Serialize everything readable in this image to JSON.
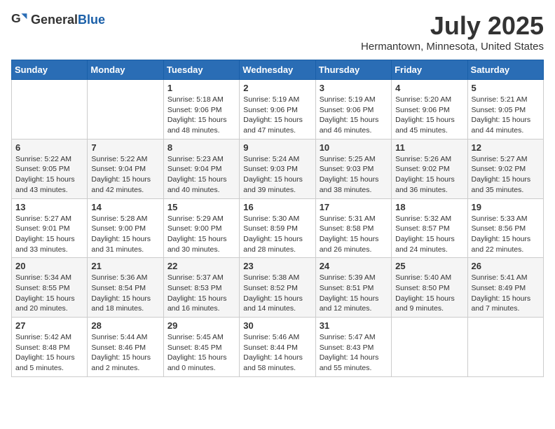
{
  "header": {
    "logo_general": "General",
    "logo_blue": "Blue",
    "month": "July 2025",
    "location": "Hermantown, Minnesota, United States"
  },
  "weekdays": [
    "Sunday",
    "Monday",
    "Tuesday",
    "Wednesday",
    "Thursday",
    "Friday",
    "Saturday"
  ],
  "weeks": [
    [
      {
        "day": "",
        "sunrise": "",
        "sunset": "",
        "daylight": ""
      },
      {
        "day": "",
        "sunrise": "",
        "sunset": "",
        "daylight": ""
      },
      {
        "day": "1",
        "sunrise": "Sunrise: 5:18 AM",
        "sunset": "Sunset: 9:06 PM",
        "daylight": "Daylight: 15 hours and 48 minutes."
      },
      {
        "day": "2",
        "sunrise": "Sunrise: 5:19 AM",
        "sunset": "Sunset: 9:06 PM",
        "daylight": "Daylight: 15 hours and 47 minutes."
      },
      {
        "day": "3",
        "sunrise": "Sunrise: 5:19 AM",
        "sunset": "Sunset: 9:06 PM",
        "daylight": "Daylight: 15 hours and 46 minutes."
      },
      {
        "day": "4",
        "sunrise": "Sunrise: 5:20 AM",
        "sunset": "Sunset: 9:06 PM",
        "daylight": "Daylight: 15 hours and 45 minutes."
      },
      {
        "day": "5",
        "sunrise": "Sunrise: 5:21 AM",
        "sunset": "Sunset: 9:05 PM",
        "daylight": "Daylight: 15 hours and 44 minutes."
      }
    ],
    [
      {
        "day": "6",
        "sunrise": "Sunrise: 5:22 AM",
        "sunset": "Sunset: 9:05 PM",
        "daylight": "Daylight: 15 hours and 43 minutes."
      },
      {
        "day": "7",
        "sunrise": "Sunrise: 5:22 AM",
        "sunset": "Sunset: 9:04 PM",
        "daylight": "Daylight: 15 hours and 42 minutes."
      },
      {
        "day": "8",
        "sunrise": "Sunrise: 5:23 AM",
        "sunset": "Sunset: 9:04 PM",
        "daylight": "Daylight: 15 hours and 40 minutes."
      },
      {
        "day": "9",
        "sunrise": "Sunrise: 5:24 AM",
        "sunset": "Sunset: 9:03 PM",
        "daylight": "Daylight: 15 hours and 39 minutes."
      },
      {
        "day": "10",
        "sunrise": "Sunrise: 5:25 AM",
        "sunset": "Sunset: 9:03 PM",
        "daylight": "Daylight: 15 hours and 38 minutes."
      },
      {
        "day": "11",
        "sunrise": "Sunrise: 5:26 AM",
        "sunset": "Sunset: 9:02 PM",
        "daylight": "Daylight: 15 hours and 36 minutes."
      },
      {
        "day": "12",
        "sunrise": "Sunrise: 5:27 AM",
        "sunset": "Sunset: 9:02 PM",
        "daylight": "Daylight: 15 hours and 35 minutes."
      }
    ],
    [
      {
        "day": "13",
        "sunrise": "Sunrise: 5:27 AM",
        "sunset": "Sunset: 9:01 PM",
        "daylight": "Daylight: 15 hours and 33 minutes."
      },
      {
        "day": "14",
        "sunrise": "Sunrise: 5:28 AM",
        "sunset": "Sunset: 9:00 PM",
        "daylight": "Daylight: 15 hours and 31 minutes."
      },
      {
        "day": "15",
        "sunrise": "Sunrise: 5:29 AM",
        "sunset": "Sunset: 9:00 PM",
        "daylight": "Daylight: 15 hours and 30 minutes."
      },
      {
        "day": "16",
        "sunrise": "Sunrise: 5:30 AM",
        "sunset": "Sunset: 8:59 PM",
        "daylight": "Daylight: 15 hours and 28 minutes."
      },
      {
        "day": "17",
        "sunrise": "Sunrise: 5:31 AM",
        "sunset": "Sunset: 8:58 PM",
        "daylight": "Daylight: 15 hours and 26 minutes."
      },
      {
        "day": "18",
        "sunrise": "Sunrise: 5:32 AM",
        "sunset": "Sunset: 8:57 PM",
        "daylight": "Daylight: 15 hours and 24 minutes."
      },
      {
        "day": "19",
        "sunrise": "Sunrise: 5:33 AM",
        "sunset": "Sunset: 8:56 PM",
        "daylight": "Daylight: 15 hours and 22 minutes."
      }
    ],
    [
      {
        "day": "20",
        "sunrise": "Sunrise: 5:34 AM",
        "sunset": "Sunset: 8:55 PM",
        "daylight": "Daylight: 15 hours and 20 minutes."
      },
      {
        "day": "21",
        "sunrise": "Sunrise: 5:36 AM",
        "sunset": "Sunset: 8:54 PM",
        "daylight": "Daylight: 15 hours and 18 minutes."
      },
      {
        "day": "22",
        "sunrise": "Sunrise: 5:37 AM",
        "sunset": "Sunset: 8:53 PM",
        "daylight": "Daylight: 15 hours and 16 minutes."
      },
      {
        "day": "23",
        "sunrise": "Sunrise: 5:38 AM",
        "sunset": "Sunset: 8:52 PM",
        "daylight": "Daylight: 15 hours and 14 minutes."
      },
      {
        "day": "24",
        "sunrise": "Sunrise: 5:39 AM",
        "sunset": "Sunset: 8:51 PM",
        "daylight": "Daylight: 15 hours and 12 minutes."
      },
      {
        "day": "25",
        "sunrise": "Sunrise: 5:40 AM",
        "sunset": "Sunset: 8:50 PM",
        "daylight": "Daylight: 15 hours and 9 minutes."
      },
      {
        "day": "26",
        "sunrise": "Sunrise: 5:41 AM",
        "sunset": "Sunset: 8:49 PM",
        "daylight": "Daylight: 15 hours and 7 minutes."
      }
    ],
    [
      {
        "day": "27",
        "sunrise": "Sunrise: 5:42 AM",
        "sunset": "Sunset: 8:48 PM",
        "daylight": "Daylight: 15 hours and 5 minutes."
      },
      {
        "day": "28",
        "sunrise": "Sunrise: 5:44 AM",
        "sunset": "Sunset: 8:46 PM",
        "daylight": "Daylight: 15 hours and 2 minutes."
      },
      {
        "day": "29",
        "sunrise": "Sunrise: 5:45 AM",
        "sunset": "Sunset: 8:45 PM",
        "daylight": "Daylight: 15 hours and 0 minutes."
      },
      {
        "day": "30",
        "sunrise": "Sunrise: 5:46 AM",
        "sunset": "Sunset: 8:44 PM",
        "daylight": "Daylight: 14 hours and 58 minutes."
      },
      {
        "day": "31",
        "sunrise": "Sunrise: 5:47 AM",
        "sunset": "Sunset: 8:43 PM",
        "daylight": "Daylight: 14 hours and 55 minutes."
      },
      {
        "day": "",
        "sunrise": "",
        "sunset": "",
        "daylight": ""
      },
      {
        "day": "",
        "sunrise": "",
        "sunset": "",
        "daylight": ""
      }
    ]
  ]
}
